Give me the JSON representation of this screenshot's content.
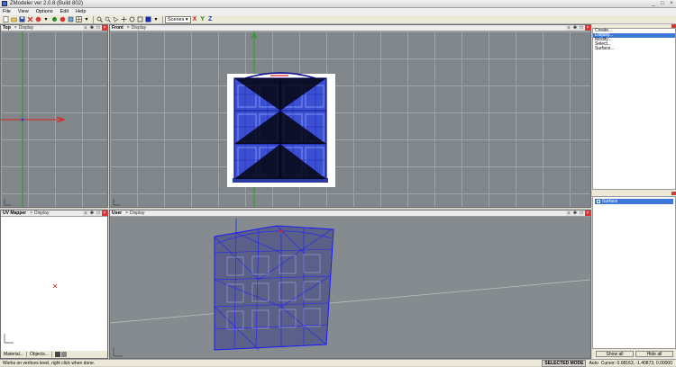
{
  "window": {
    "title": "ZModeler ver 2.0.8 (Build 802)",
    "min": "_",
    "max": "□",
    "close": "×"
  },
  "menu": [
    "File",
    "View",
    "Options",
    "Edit",
    "Help"
  ],
  "toolbar": {
    "selection_mode": "Scenes",
    "axis_x": "X",
    "axis_y": "Y",
    "axis_z": "Z"
  },
  "viewports": {
    "top": {
      "name": "Top",
      "tab": "Display"
    },
    "front": {
      "name": "Front",
      "tab": "Display"
    },
    "uv": {
      "name": "UV Mapper",
      "tab": "Display"
    },
    "user": {
      "name": "User",
      "tab": "Display"
    }
  },
  "uv_tabs": [
    "Material...",
    "Objects..."
  ],
  "right_panel": {
    "menu": [
      "Create...",
      "Display...",
      "Modify...",
      "Select...",
      "Surface..."
    ],
    "selected_index": 1,
    "tree_item": "Surface",
    "show_all": "Show all",
    "hide_all": "Hide all"
  },
  "status": {
    "hint": "Works on vertices level, right click when done.",
    "mode": "SELECTED MODE",
    "auto": "Auto",
    "cursor": "Cursor: 0.08163, -1.40873, 0.00000"
  },
  "colors": {
    "grid": "#808689",
    "mesh": "#1a1aff",
    "axis_x": "#e02020",
    "axis_y": "#20a020",
    "axis_z": "#2040e0"
  }
}
